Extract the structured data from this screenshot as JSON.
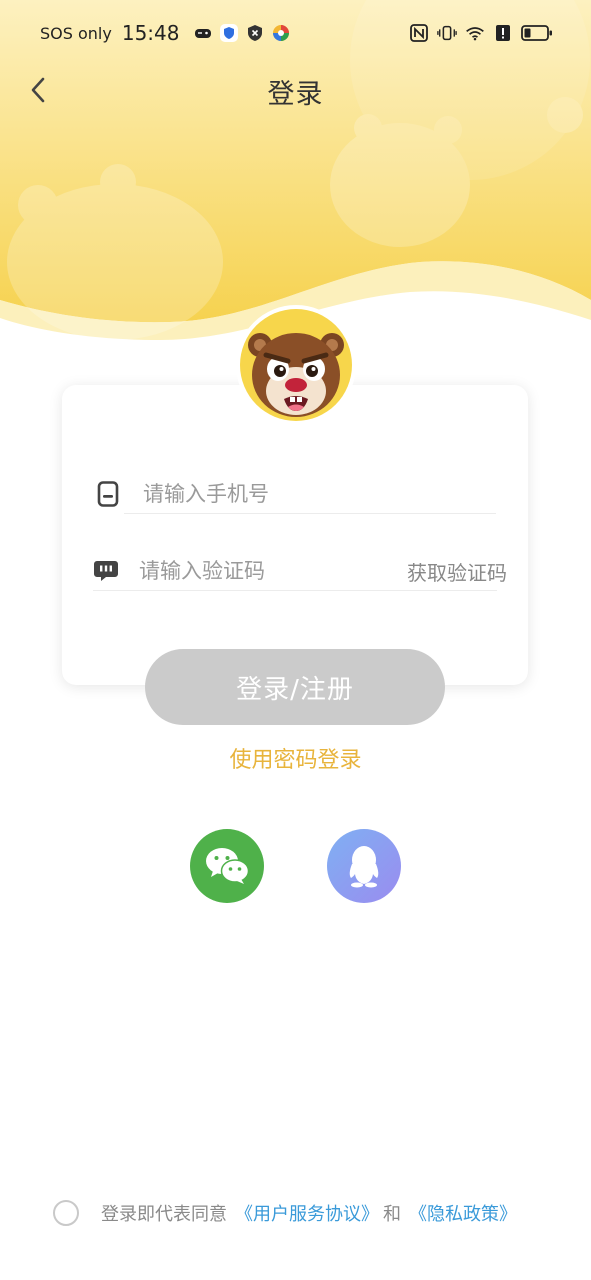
{
  "status_bar": {
    "carrier": "SOS only",
    "time": "15:48"
  },
  "nav": {
    "title": "登录",
    "back_icon": "chevron-left-icon"
  },
  "form": {
    "phone_placeholder": "请输入手机号",
    "code_placeholder": "请输入验证码",
    "get_code_label": "获取验证码",
    "submit_label": "登录/注册"
  },
  "alt_login": {
    "password_login_label": "使用密码登录",
    "social": [
      "wechat-icon",
      "qq-icon"
    ]
  },
  "agreement": {
    "prefix": "登录即代表同意",
    "user_agreement": "《用户服务协议》",
    "and": "和",
    "privacy_policy": "《隐私政策》"
  },
  "colors": {
    "header_yellow": "#f7d55a",
    "accent_text": "#e8b43c",
    "button_disabled": "#cbcbcb",
    "link": "#3a9ad9",
    "wechat": "#4fb14a"
  }
}
